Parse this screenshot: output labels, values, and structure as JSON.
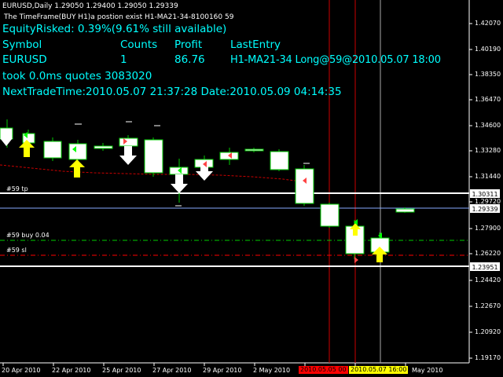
{
  "header": {
    "symbol_line": "EURUSD,Daily  1.29050 1.29400 1.29050 1.29339",
    "status_line": "The TimeFrame(BUY H1)a postion exist H1-MA21-34-8100160 59"
  },
  "info_panel": {
    "equity_risked": "EquityRisked: 0.39%(9.61% still available)",
    "table_headers": [
      "Symbol",
      "Counts",
      "Profit",
      "LastEntry"
    ],
    "table_row": [
      "EURUSD",
      "1",
      "86.76",
      "H1-MA21-34 Long@59@2010.05.07 18:00"
    ],
    "quotes": "took 0.0ms quotes 3083020",
    "next_trade": "NextTradeTime:2010.05.07 21:37:28 Date:2010.05.09 04:14:35"
  },
  "levels": {
    "tp_label": "#59 tp",
    "buy_label": "#59 buy 0.04",
    "sl_label": "#59 sl"
  },
  "price_axis": {
    "ticks": [
      "1.42070",
      "1.40190",
      "1.38350",
      "1.36470",
      "1.34600",
      "1.33280",
      "1.31440",
      "1.29720",
      "1.27900",
      "1.26220",
      "1.24420",
      "1.22670",
      "1.20920",
      "1.19170"
    ],
    "highlighted": [
      "1.30311",
      "1.29339",
      "1.23951"
    ]
  },
  "time_axis": {
    "labels": [
      "20 Apr 2010",
      "22 Apr 2010",
      "25 Apr 2010",
      "27 Apr 2010",
      "29 Apr 2010",
      "2 May 2010",
      "May 2010"
    ],
    "highlight_red": "2010.05.05 00",
    "highlight_yellow": "2010.05.07 16:00"
  },
  "colors": {
    "background": "#000000",
    "text": "#ffffff",
    "info": "#00ffff",
    "candle_border": "#00cc00",
    "candle_body": "#ffffff",
    "ma_line": "#cc0000",
    "entry_line": "#00cc00",
    "sl_line": "#ff0000",
    "arrow_up": "#ffff00",
    "arrow_down": "#ffffff",
    "vline_red": "#cc0000",
    "vline_white": "#aaaaaa",
    "axis_highlight_red": "#ff0000",
    "axis_highlight_yellow": "#ffff00"
  }
}
